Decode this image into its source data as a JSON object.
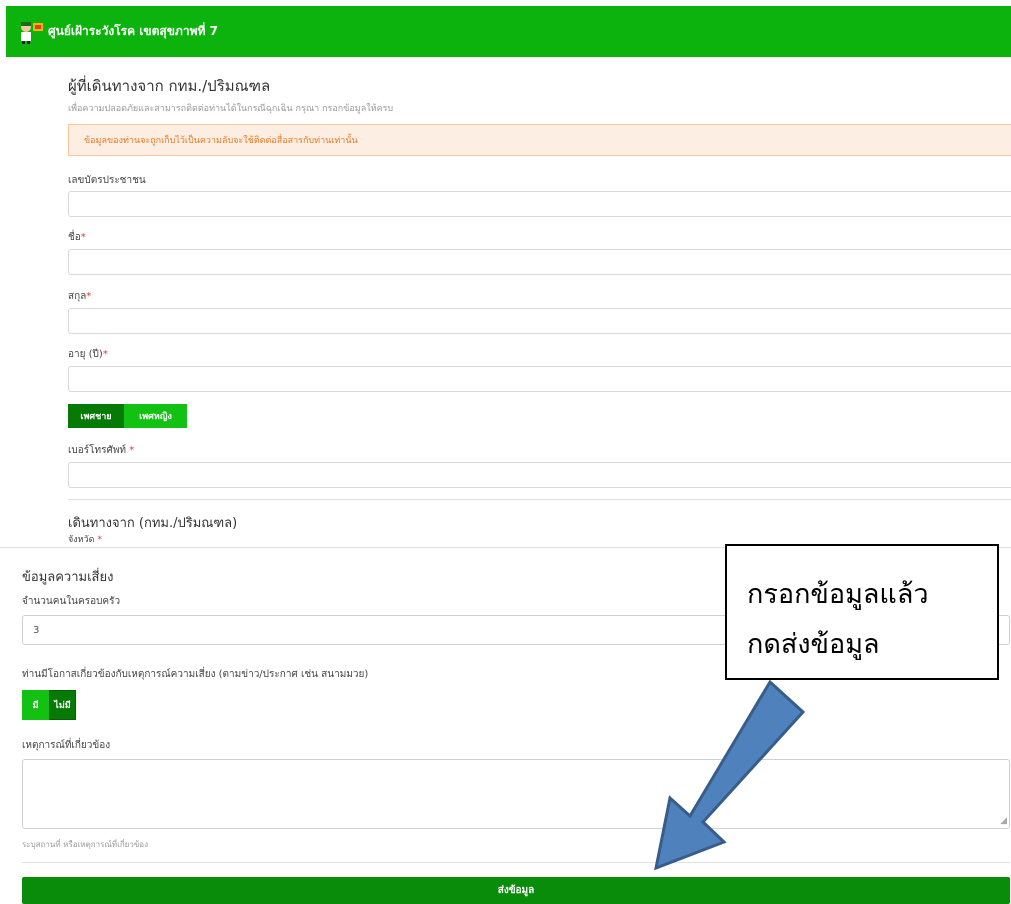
{
  "header": {
    "brand": "ศูนย์เฝ้าระวังโรค เขตสุขภาพที่ 7"
  },
  "traveler_section": {
    "title": "ผู้ที่เดินทางจาก กทม./ปริมณฑล",
    "subtitle": "เพื่อความปลอดภัยและสามารถติดต่อท่านได้ในกรณีฉุกเฉิน กรุณา กรอกข้อมูลให้ครบ",
    "alert": "ข้อมูลของท่านจะถูกเก็บไว้เป็นความลับจะใช้ติดต่อสื่อสารกับท่านเท่านั้น",
    "id_label": "เลขบัตรประชาชน",
    "first_name_label": "ชื่อ",
    "last_name_label": "สกุล",
    "age_label": "อายุ (ปี)",
    "gender_male": "เพศชาย",
    "gender_female": "เพศหญิง",
    "phone_label": "เบอร์โทรศัพท์ ",
    "required_mark": "*"
  },
  "origin_section": {
    "title": "เดินทางจาก (กทม./ปริมณฑล)",
    "province_label": "จังหวัด "
  },
  "risk_section": {
    "title": "ข้อมูลความเสี่ยง",
    "family_label": "จำนวนคนในครอบครัว",
    "family_value": "3",
    "event_question": "ท่านมีโอกาสเกี่ยวข้องกับเหตุการณ์ความเสี่ยง (ตามข่าว/ประกาศ เช่น สนามมวย)",
    "yes": "มี",
    "no": "ไม่มี",
    "events_label": "เหตุการณ์ที่เกี่ยวข้อง",
    "events_help": "ระบุสถานที่ หรือเหตุการณ์ที่เกี่ยวข้อง"
  },
  "submit_label": "ส่งข้อมูล",
  "callout": {
    "line1": "กรอกข้อมูลแล้ว",
    "line2": "กดส่งข้อมูล"
  },
  "colors": {
    "brand_green": "#0cb30c",
    "dark_green": "#057a05",
    "callout_arrow": "#4f81bd"
  }
}
